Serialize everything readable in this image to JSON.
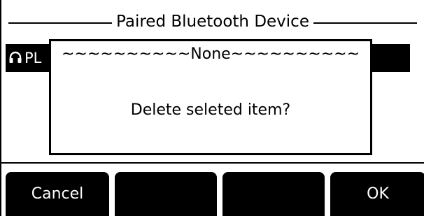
{
  "header": {
    "title": "Paired Bluetooth Device"
  },
  "list": {
    "items": [
      {
        "icon": "headphones-icon",
        "label": "PL"
      }
    ]
  },
  "dialog": {
    "title": "~~~~~~~~~~None~~~~~~~~~~",
    "message": "Delete seleted item?"
  },
  "softkeys": [
    "Cancel",
    "",
    "",
    "OK"
  ]
}
